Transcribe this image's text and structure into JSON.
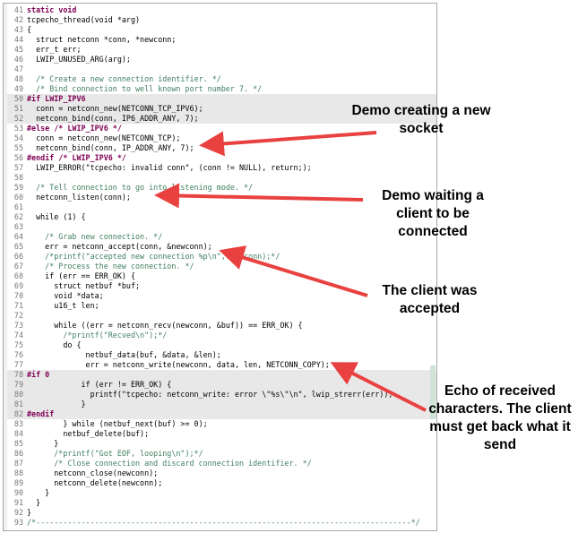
{
  "code_lines": [
    {
      "n": "41",
      "t": "static void",
      "k": "kw"
    },
    {
      "n": "42",
      "t": "tcpecho_thread(void *arg)",
      "k": "code"
    },
    {
      "n": "43",
      "t": "{",
      "k": "code"
    },
    {
      "n": "44",
      "t": "  struct netconn *conn, *newconn;",
      "k": "code"
    },
    {
      "n": "45",
      "t": "  err_t err;",
      "k": "code"
    },
    {
      "n": "46",
      "t": "  LWIP_UNUSED_ARG(arg);",
      "k": "code"
    },
    {
      "n": "47",
      "t": "",
      "k": "code"
    },
    {
      "n": "48",
      "t": "  /* Create a new connection identifier. */",
      "k": "cm"
    },
    {
      "n": "49",
      "t": "  /* Bind connection to well known port number 7. */",
      "k": "cm"
    },
    {
      "n": "50",
      "t": "#if LWIP_IPV6",
      "k": "kw",
      "inactive": true
    },
    {
      "n": "51",
      "t": "  conn = netconn_new(NETCONN_TCP_IPV6);",
      "k": "code",
      "inactive": true
    },
    {
      "n": "52",
      "t": "  netconn_bind(conn, IP6_ADDR_ANY, 7);",
      "k": "code",
      "inactive": true
    },
    {
      "n": "53",
      "t": "#else /* LWIP_IPV6 */",
      "k": "kw"
    },
    {
      "n": "54",
      "t": "  conn = netconn_new(NETCONN_TCP);",
      "k": "code"
    },
    {
      "n": "55",
      "t": "  netconn_bind(conn, IP_ADDR_ANY, 7);",
      "k": "code"
    },
    {
      "n": "56",
      "t": "#endif /* LWIP_IPV6 */",
      "k": "kw"
    },
    {
      "n": "57",
      "t": "  LWIP_ERROR(\"tcpecho: invalid conn\", (conn != NULL), return;);",
      "k": "code"
    },
    {
      "n": "58",
      "t": "",
      "k": "code"
    },
    {
      "n": "59",
      "t": "  /* Tell connection to go into listening mode. */",
      "k": "cm"
    },
    {
      "n": "60",
      "t": "  netconn_listen(conn);",
      "k": "code"
    },
    {
      "n": "61",
      "t": "",
      "k": "code"
    },
    {
      "n": "62",
      "t": "  while (1) {",
      "k": "code"
    },
    {
      "n": "63",
      "t": "",
      "k": "code"
    },
    {
      "n": "64",
      "t": "    /* Grab new connection. */",
      "k": "cm"
    },
    {
      "n": "65",
      "t": "    err = netconn_accept(conn, &newconn);",
      "k": "code"
    },
    {
      "n": "66",
      "t": "    /*printf(\"accepted new connection %p\\n\", newconn);*/",
      "k": "cm"
    },
    {
      "n": "67",
      "t": "    /* Process the new connection. */",
      "k": "cm"
    },
    {
      "n": "68",
      "t": "    if (err == ERR_OK) {",
      "k": "code"
    },
    {
      "n": "69",
      "t": "      struct netbuf *buf;",
      "k": "code"
    },
    {
      "n": "70",
      "t": "      void *data;",
      "k": "code"
    },
    {
      "n": "71",
      "t": "      u16_t len;",
      "k": "code"
    },
    {
      "n": "72",
      "t": "",
      "k": "code"
    },
    {
      "n": "73",
      "t": "      while ((err = netconn_recv(newconn, &buf)) == ERR_OK) {",
      "k": "code"
    },
    {
      "n": "74",
      "t": "        /*printf(\"Recved\\n\");*/",
      "k": "cm"
    },
    {
      "n": "75",
      "t": "        do {",
      "k": "code"
    },
    {
      "n": "76",
      "t": "             netbuf_data(buf, &data, &len);",
      "k": "code"
    },
    {
      "n": "77",
      "t": "             err = netconn_write(newconn, data, len, NETCONN_COPY);",
      "k": "code"
    },
    {
      "n": "78",
      "t": "#if 0",
      "k": "kw",
      "inactive": true
    },
    {
      "n": "79",
      "t": "            if (err != ERR_OK) {",
      "k": "code",
      "inactive": true
    },
    {
      "n": "80",
      "t": "              printf(\"tcpecho: netconn_write: error \\\"%s\\\"\\n\", lwip_strerr(err));",
      "k": "code",
      "inactive": true
    },
    {
      "n": "81",
      "t": "            }",
      "k": "code",
      "inactive": true
    },
    {
      "n": "82",
      "t": "#endif",
      "k": "kw",
      "inactive": true
    },
    {
      "n": "83",
      "t": "        } while (netbuf_next(buf) >= 0);",
      "k": "code"
    },
    {
      "n": "84",
      "t": "        netbuf_delete(buf);",
      "k": "code"
    },
    {
      "n": "85",
      "t": "      }",
      "k": "code"
    },
    {
      "n": "86",
      "t": "      /*printf(\"Got EOF, looping\\n\");*/",
      "k": "cm"
    },
    {
      "n": "87",
      "t": "      /* Close connection and discard connection identifier. */",
      "k": "cm"
    },
    {
      "n": "88",
      "t": "      netconn_close(newconn);",
      "k": "code"
    },
    {
      "n": "89",
      "t": "      netconn_delete(newconn);",
      "k": "code"
    },
    {
      "n": "90",
      "t": "    }",
      "k": "code"
    },
    {
      "n": "91",
      "t": "  }",
      "k": "code"
    },
    {
      "n": "92",
      "t": "}",
      "k": "code"
    },
    {
      "n": "93",
      "t": "/*-----------------------------------------------------------------------------------*/",
      "k": "cm"
    }
  ],
  "callouts": {
    "socket": "Demo creating a new socket",
    "listen": "Demo waiting a client to be connected",
    "accepted": "The client was accepted",
    "echo": "Echo of received characters. The client must get back what it send"
  },
  "colors": {
    "arrow": "#e8413f",
    "keyword": "#7f0055",
    "comment": "#3f7f5f"
  }
}
